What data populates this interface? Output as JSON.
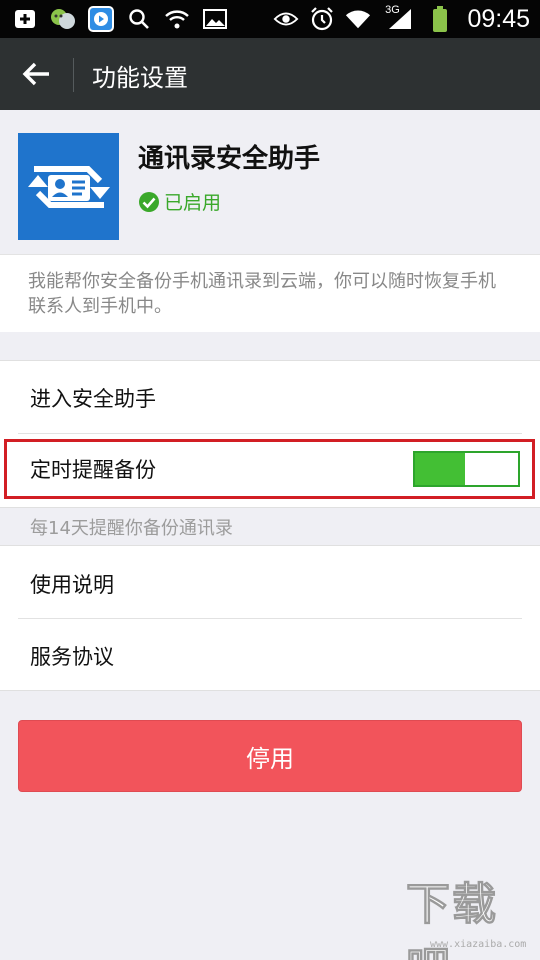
{
  "status_bar": {
    "time": "09:45",
    "network_label": "3G",
    "icons": [
      "add-box-icon",
      "chat-icon",
      "video-app-icon",
      "search-icon",
      "wifi-question-icon",
      "image-icon",
      "eye-icon",
      "alarm-icon",
      "wifi-icon",
      "signal-icon",
      "battery-icon"
    ]
  },
  "title_bar": {
    "back_icon": "back-arrow-icon",
    "title": "功能设置"
  },
  "plugin": {
    "name": "通讯录安全助手",
    "status": "已启用",
    "status_icon": "check-circle-icon",
    "description": "我能帮你安全备份手机通讯录到云端，你可以随时恢复手机联系人到手机中。"
  },
  "settings": {
    "enter_assistant": "进入安全助手",
    "timed_reminder": "定时提醒备份",
    "timed_reminder_on": true,
    "reminder_hint": "每14天提醒你备份通讯录",
    "usage_guide": "使用说明",
    "service_agreement": "服务协议"
  },
  "actions": {
    "disable": "停用"
  },
  "watermark": {
    "text": "下载吧",
    "url": "www.xiazaiba.com"
  },
  "colors": {
    "title_bar": "#2d3132",
    "enabled_green": "#3aa82a",
    "toggle_green": "#43bf34",
    "disable_red": "#f2545b",
    "highlight_red": "#d21e24",
    "app_icon_blue": "#1f74cc"
  }
}
